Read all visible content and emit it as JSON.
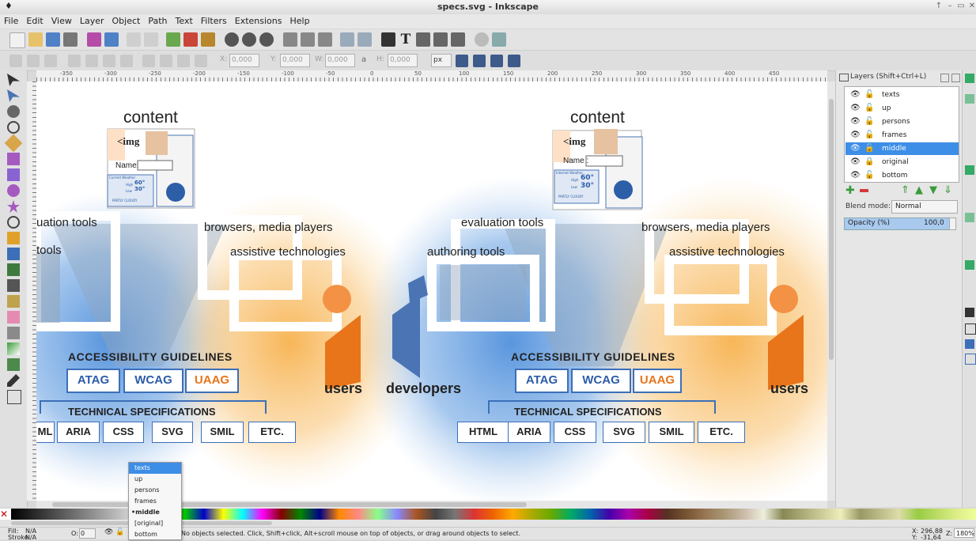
{
  "window": {
    "title": "specs.svg - Inkscape",
    "buttons": [
      "↑",
      "–",
      "▭",
      "✕"
    ]
  },
  "menu": [
    "File",
    "Edit",
    "View",
    "Layer",
    "Object",
    "Path",
    "Text",
    "Filters",
    "Extensions",
    "Help"
  ],
  "controls": {
    "x_label": "X:",
    "x_value": "0,000",
    "y_label": "Y:",
    "y_value": "0,000",
    "w_label": "W:",
    "w_value": "0,000",
    "h_label": "H:",
    "h_value": "0,000",
    "unit": "px"
  },
  "ruler_ticks": [
    "-350",
    "-300",
    "-250",
    "-200",
    "-150",
    "-100",
    "-50",
    "0",
    "50",
    "100",
    "150",
    "200",
    "250",
    "300",
    "350",
    "400",
    "450"
  ],
  "layers_panel": {
    "title": "Layers (Shift+Ctrl+L)",
    "layers": [
      {
        "name": "texts",
        "selected": false,
        "locked": false
      },
      {
        "name": "up",
        "selected": false,
        "locked": false
      },
      {
        "name": "persons",
        "selected": false,
        "locked": false
      },
      {
        "name": "frames",
        "selected": false,
        "locked": false
      },
      {
        "name": "middle",
        "selected": true,
        "locked": false
      },
      {
        "name": "original",
        "selected": false,
        "locked": true
      },
      {
        "name": "bottom",
        "selected": false,
        "locked": false
      }
    ],
    "blend_label": "Blend mode:",
    "blend_value": "Normal",
    "opacity_label": "Opacity (%)",
    "opacity_value": "100,0"
  },
  "layer_popup": [
    "texts",
    "up",
    "persons",
    "frames",
    "•middle",
    "[original]",
    "bottom"
  ],
  "status": {
    "fill_label": "Fill:",
    "fill_value": "N/A",
    "stroke_label": "Stroke:",
    "stroke_value": "N/A",
    "opacity_label": "O:",
    "opacity_value": "0",
    "message": "No objects selected. Click, Shift+click, Alt+scroll mouse on top of objects, or drag around objects to select.",
    "x_label": "X:",
    "x_value": "296,88",
    "y_label": "Y:",
    "y_value": "-31,64",
    "z_label": "Z:",
    "zoom": "180%"
  },
  "drawing": {
    "content": "content",
    "img_tag": "<img",
    "name_label": "Name :",
    "name_label_left": "Name:",
    "weather_title": "Current Weather",
    "weather_title_right": "Internet Weather",
    "weather_temp_high": "60°",
    "weather_temp_low": "30°",
    "weather_high_label": "High",
    "weather_low_label": "Low",
    "weather_desc": "PARTLY CLOUDY",
    "evaluation_tools": "evaluation tools",
    "evaluation_tools_left": "uation tools",
    "authoring_tools": "authoring tools",
    "authoring_tools_left": "tools",
    "browsers": "browsers, media players",
    "assistive": "assistive technologies",
    "developers": "developers",
    "users": "users",
    "guidelines_title": "ACCESSIBILITY GUIDELINES",
    "guidelines": [
      "ATAG",
      "WCAG",
      "UAAG"
    ],
    "specs_title": "TECHNICAL SPECIFICATIONS",
    "specs": [
      "HTML",
      "ARIA",
      "CSS",
      "SVG",
      "SMIL",
      "ETC."
    ],
    "specs_left_first": "ML"
  },
  "colors": {
    "blue": "#3c6fb8",
    "orange": "#e8751a",
    "selection": "#3d8ee6",
    "uaag": "#e8751a"
  }
}
